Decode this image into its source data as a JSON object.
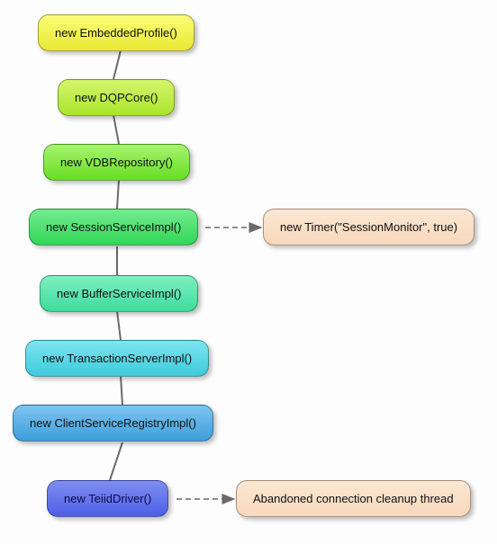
{
  "chart_data": {
    "type": "flow",
    "title": "",
    "main_chain": [
      {
        "id": "n1",
        "label": "new EmbeddedProfile()"
      },
      {
        "id": "n2",
        "label": "new DQPCore()"
      },
      {
        "id": "n3",
        "label": "new VDBRepository()"
      },
      {
        "id": "n4",
        "label": "new SessionServiceImpl()"
      },
      {
        "id": "n5",
        "label": "new BufferServiceImpl()"
      },
      {
        "id": "n6",
        "label": "new TransactionServerImpl()"
      },
      {
        "id": "n7",
        "label": "new ClientServiceRegistryImpl()"
      },
      {
        "id": "n8",
        "label": "new TeiidDriver()"
      }
    ],
    "side_nodes": [
      {
        "id": "s1",
        "from": "n4",
        "label": "new Timer(\"SessionMonitor\", true)"
      },
      {
        "id": "s2",
        "from": "n8",
        "label": "Abandoned connection cleanup thread"
      }
    ],
    "edges_plain": [
      [
        "n1",
        "n2"
      ],
      [
        "n2",
        "n3"
      ],
      [
        "n3",
        "n4"
      ],
      [
        "n4",
        "n5"
      ],
      [
        "n5",
        "n6"
      ],
      [
        "n6",
        "n7"
      ],
      [
        "n7",
        "n8"
      ]
    ],
    "edges_arrow": [
      [
        "n4",
        "s1"
      ],
      [
        "n8",
        "s2"
      ]
    ]
  }
}
